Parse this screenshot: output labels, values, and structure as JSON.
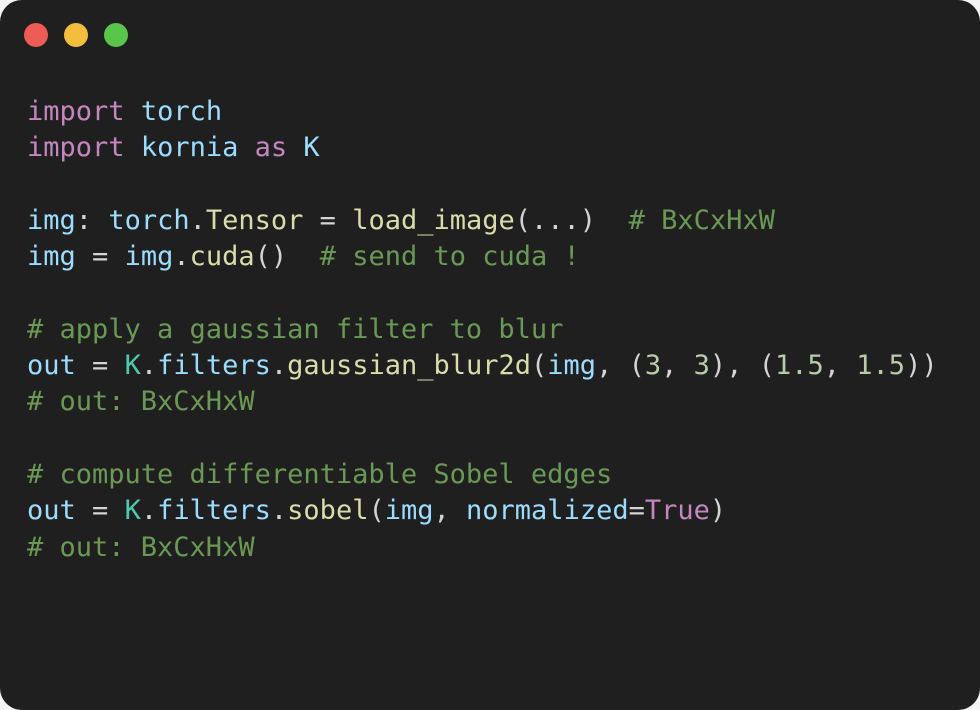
{
  "window": {
    "controls": {
      "close": "close",
      "minimize": "minimize",
      "maximize": "maximize"
    }
  },
  "code": {
    "l1": {
      "kw": "import",
      "mod": "torch"
    },
    "l2": {
      "kw": "import",
      "mod": "kornia",
      "kw2": "as",
      "alias": "K"
    },
    "l4": {
      "var": "img",
      "colon": ":",
      "mod": "torch",
      "dot": ".",
      "cls": "Tensor",
      "eq": "=",
      "fn": "load_image",
      "args": "(...)",
      "cm": "# BxCxHxW"
    },
    "l5": {
      "var": "img",
      "eq": "=",
      "obj": "img",
      "dot": ".",
      "fn": "cuda",
      "args": "()",
      "cm": "# send to cuda !"
    },
    "l7": {
      "cm": "# apply a gaussian filter to blur"
    },
    "l8": {
      "var": "out",
      "eq": "=",
      "obj": "K",
      "dot": ".",
      "attr": "filters",
      "dot2": ".",
      "fn": "gaussian_blur2d",
      "open": "(",
      "arg": "img",
      "comma": ",",
      "t1open": "(",
      "n1": "3",
      "c1": ",",
      "n2": "3",
      "t1close": ")",
      "comma2": ",",
      "t2open": "(",
      "n3": "1.5",
      "c2": ",",
      "n4": "1.5",
      "t2close": "))"
    },
    "l9": {
      "cm": "# out: BxCxHxW"
    },
    "l11": {
      "cm": "# compute differentiable Sobel edges"
    },
    "l12": {
      "var": "out",
      "eq": "=",
      "obj": "K",
      "dot": ".",
      "attr": "filters",
      "dot2": ".",
      "fn": "sobel",
      "open": "(",
      "arg": "img",
      "comma": ",",
      "kwarg": "normalized",
      "kweq": "=",
      "val": "True",
      "close": ")"
    },
    "l13": {
      "cm": "# out: BxCxHxW"
    }
  },
  "colors": {
    "background": "#1f1f1f",
    "keyword": "#c586c0",
    "variable": "#9cdcfe",
    "class": "#4ec9b0",
    "function": "#dcdcaa",
    "number": "#b5cea8",
    "comment": "#6a9955",
    "close_dot": "#ee5c55",
    "minimize_dot": "#f4bd3b",
    "maximize_dot": "#5ac54d"
  }
}
